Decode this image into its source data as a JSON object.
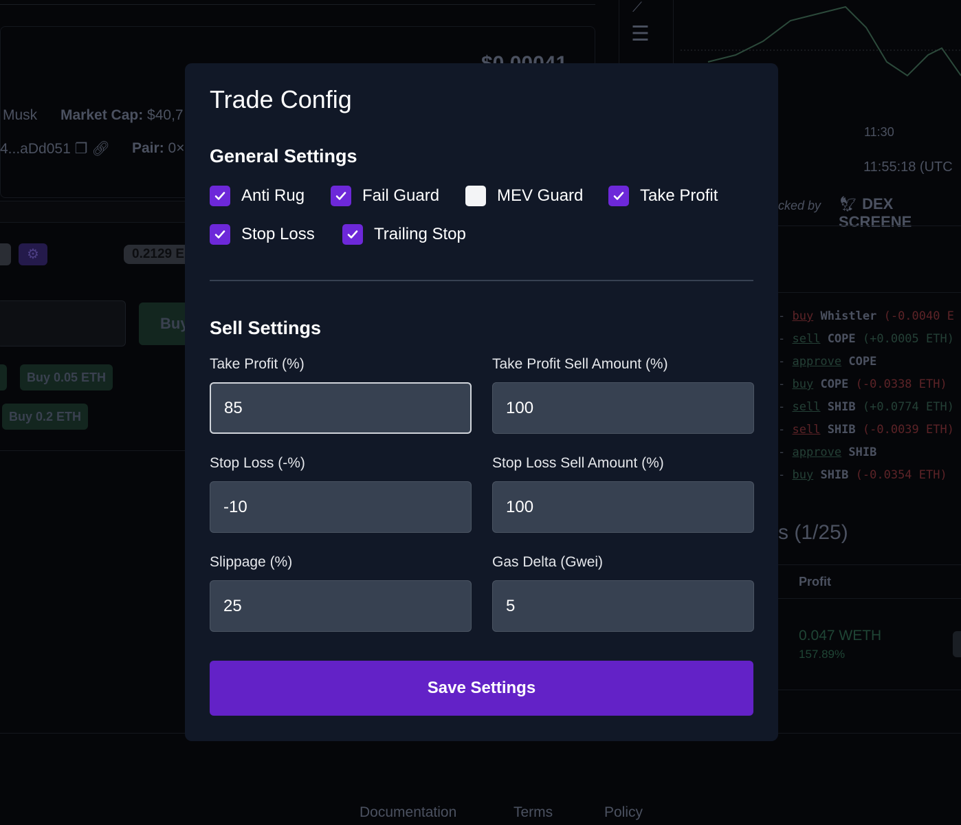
{
  "background": {
    "price": "$0.00041",
    "token_name": "Musk",
    "market_cap_label": "Market Cap:",
    "market_cap_value": "$40,7",
    "address": "4...aDd051",
    "pair_label": "Pair:",
    "pair_value": "0×",
    "balance": "0.2129 E",
    "buy_label": "Buy",
    "quick_buys": [
      "Buy 0.05 ETH",
      "Buy 0.2 ETH"
    ],
    "time_axis": "11:30",
    "clock": "11:55:18 (UTC",
    "tracked_by": "cked by",
    "dex_brand": "DEX SCREENE",
    "logs": [
      {
        "action": "buy",
        "token": "Whistler",
        "amount": "(-0.0040 E",
        "action_color": "red",
        "amount_color": "red"
      },
      {
        "action": "sell",
        "token": "COPE",
        "amount": "(+0.0005 ETH)",
        "action_color": "green",
        "amount_color": "green"
      },
      {
        "action": "approve",
        "token": "COPE",
        "amount": "",
        "action_color": "green",
        "amount_color": "green"
      },
      {
        "action": "buy",
        "token": "COPE",
        "amount": "(-0.0338 ETH)",
        "action_color": "green",
        "amount_color": "red"
      },
      {
        "action": "sell",
        "token": "SHIB",
        "amount": "(+0.0774 ETH)",
        "action_color": "green",
        "amount_color": "green"
      },
      {
        "action": "sell",
        "token": "SHIB",
        "amount": "(-0.0039 ETH)",
        "action_color": "red",
        "amount_color": "red"
      },
      {
        "action": "approve",
        "token": "SHIB",
        "amount": "",
        "action_color": "green",
        "amount_color": "green"
      },
      {
        "action": "buy",
        "token": "SHIB",
        "amount": "(-0.0354 ETH)",
        "action_color": "green",
        "amount_color": "red"
      }
    ],
    "positions_title": "s (1/25)",
    "profit_header": "Profit",
    "profit_value": "0.047 WETH",
    "profit_pct": "157.89%",
    "footer": [
      "Documentation",
      "Terms",
      "Policy"
    ]
  },
  "modal": {
    "title": "Trade Config",
    "general_title": "General Settings",
    "checkboxes": [
      {
        "label": "Anti Rug",
        "checked": true
      },
      {
        "label": "Fail Guard",
        "checked": true
      },
      {
        "label": "MEV Guard",
        "checked": false
      },
      {
        "label": "Take Profit",
        "checked": true
      },
      {
        "label": "Stop Loss",
        "checked": true
      },
      {
        "label": "Trailing Stop",
        "checked": true
      }
    ],
    "sell_title": "Sell Settings",
    "fields": [
      {
        "label": "Take Profit (%)",
        "value": "85"
      },
      {
        "label": "Take Profit Sell Amount (%)",
        "value": "100"
      },
      {
        "label": "Stop Loss (-%)",
        "value": "-10"
      },
      {
        "label": "Stop Loss Sell Amount (%)",
        "value": "100"
      },
      {
        "label": "Slippage (%)",
        "value": "25"
      },
      {
        "label": "Gas Delta (Gwei)",
        "value": "5"
      }
    ],
    "save_label": "Save Settings",
    "accent": "#6322c7"
  }
}
